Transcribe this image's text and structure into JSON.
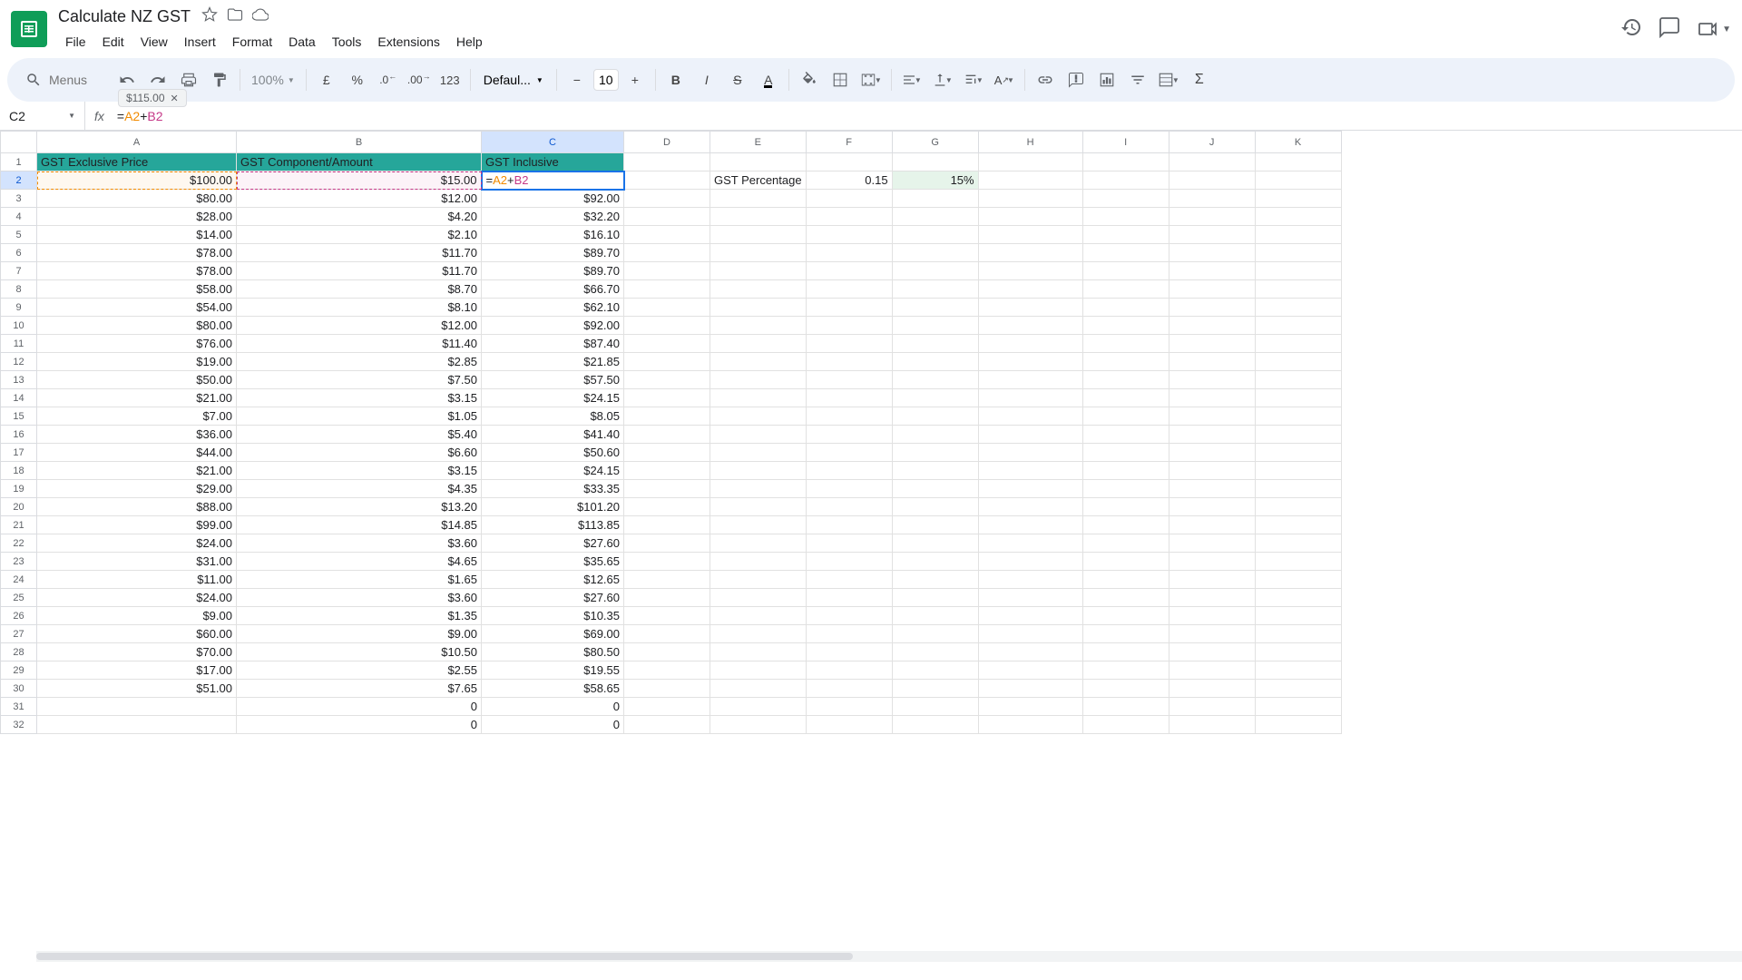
{
  "doc": {
    "title": "Calculate NZ GST"
  },
  "menus": [
    "File",
    "Edit",
    "View",
    "Insert",
    "Format",
    "Data",
    "Tools",
    "Extensions",
    "Help"
  ],
  "toolbar": {
    "search_placeholder": "Menus",
    "zoom": "100%",
    "currency": "£",
    "percent": "%",
    "dec_dec": ".0",
    "inc_dec": ".00",
    "num_fmt": "123",
    "font": "Defaul...",
    "font_size": "10"
  },
  "formula_bar": {
    "name_box": "C2",
    "formula_eq": "=",
    "formula_ref1": "A2",
    "formula_plus": "+",
    "formula_ref2": "B2",
    "result_tip": "$115.00"
  },
  "columns": [
    "A",
    "B",
    "C",
    "D",
    "E",
    "F",
    "G",
    "H",
    "I",
    "J",
    "K"
  ],
  "headers": {
    "a": "GST Exclusive Price",
    "b": "GST Component/Amount",
    "c": "GST Inclusive"
  },
  "side": {
    "label": "GST Percentage",
    "val_f": "0.15",
    "val_g": "15%"
  },
  "rows": [
    {
      "a": "$100.00",
      "b": "$15.00",
      "c": ""
    },
    {
      "a": "$80.00",
      "b": "$12.00",
      "c": "$92.00"
    },
    {
      "a": "$28.00",
      "b": "$4.20",
      "c": "$32.20"
    },
    {
      "a": "$14.00",
      "b": "$2.10",
      "c": "$16.10"
    },
    {
      "a": "$78.00",
      "b": "$11.70",
      "c": "$89.70"
    },
    {
      "a": "$78.00",
      "b": "$11.70",
      "c": "$89.70"
    },
    {
      "a": "$58.00",
      "b": "$8.70",
      "c": "$66.70"
    },
    {
      "a": "$54.00",
      "b": "$8.10",
      "c": "$62.10"
    },
    {
      "a": "$80.00",
      "b": "$12.00",
      "c": "$92.00"
    },
    {
      "a": "$76.00",
      "b": "$11.40",
      "c": "$87.40"
    },
    {
      "a": "$19.00",
      "b": "$2.85",
      "c": "$21.85"
    },
    {
      "a": "$50.00",
      "b": "$7.50",
      "c": "$57.50"
    },
    {
      "a": "$21.00",
      "b": "$3.15",
      "c": "$24.15"
    },
    {
      "a": "$7.00",
      "b": "$1.05",
      "c": "$8.05"
    },
    {
      "a": "$36.00",
      "b": "$5.40",
      "c": "$41.40"
    },
    {
      "a": "$44.00",
      "b": "$6.60",
      "c": "$50.60"
    },
    {
      "a": "$21.00",
      "b": "$3.15",
      "c": "$24.15"
    },
    {
      "a": "$29.00",
      "b": "$4.35",
      "c": "$33.35"
    },
    {
      "a": "$88.00",
      "b": "$13.20",
      "c": "$101.20"
    },
    {
      "a": "$99.00",
      "b": "$14.85",
      "c": "$113.85"
    },
    {
      "a": "$24.00",
      "b": "$3.60",
      "c": "$27.60"
    },
    {
      "a": "$31.00",
      "b": "$4.65",
      "c": "$35.65"
    },
    {
      "a": "$11.00",
      "b": "$1.65",
      "c": "$12.65"
    },
    {
      "a": "$24.00",
      "b": "$3.60",
      "c": "$27.60"
    },
    {
      "a": "$9.00",
      "b": "$1.35",
      "c": "$10.35"
    },
    {
      "a": "$60.00",
      "b": "$9.00",
      "c": "$69.00"
    },
    {
      "a": "$70.00",
      "b": "$10.50",
      "c": "$80.50"
    },
    {
      "a": "$17.00",
      "b": "$2.55",
      "c": "$19.55"
    },
    {
      "a": "$51.00",
      "b": "$7.65",
      "c": "$58.65"
    },
    {
      "a": "",
      "b": "0",
      "c": "0"
    },
    {
      "a": "",
      "b": "0",
      "c": "0"
    }
  ]
}
